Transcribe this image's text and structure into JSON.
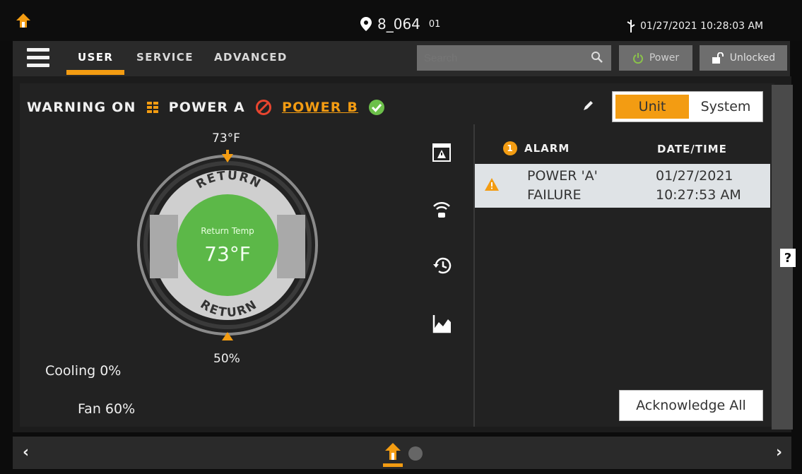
{
  "status_bar": {
    "location": "8_064",
    "location_suffix": "01",
    "datetime": "01/27/2021 10:28:03 AM"
  },
  "nav": {
    "tabs": [
      {
        "label": "USER",
        "active": true
      },
      {
        "label": "SERVICE",
        "active": false
      },
      {
        "label": "ADVANCED",
        "active": false
      }
    ],
    "search_placeholder": "Search",
    "power_label": "Power",
    "lock_label": "Unlocked"
  },
  "status_row": {
    "warning": "WARNING ON",
    "power_a": "POWER A",
    "power_b": "POWER B"
  },
  "view_toggle": {
    "unit": "Unit",
    "system": "System",
    "selected": "Unit"
  },
  "dial": {
    "setpoint_top": "73°F",
    "setpoint_bottom": "50%",
    "top_label": "RETURN",
    "bottom_label": "RETURN",
    "center_label": "Return Temp",
    "center_value": "73°F"
  },
  "readouts": {
    "cooling": "Cooling 0%",
    "fan": "Fan 60%"
  },
  "alarms": {
    "count": "1",
    "header_alarm": "ALARM",
    "header_datetime": "DATE/TIME",
    "rows": [
      {
        "line1": "POWER 'A'",
        "line2": "FAILURE",
        "date": "01/27/2021",
        "time": "10:27:53 AM"
      }
    ]
  },
  "help_label": "?",
  "acknowledge_label": "Acknowledge All",
  "colors": {
    "accent": "#f39c12",
    "center_green": "#5cb848",
    "ok_green": "#6cc04a",
    "error_red": "#e8452f"
  }
}
